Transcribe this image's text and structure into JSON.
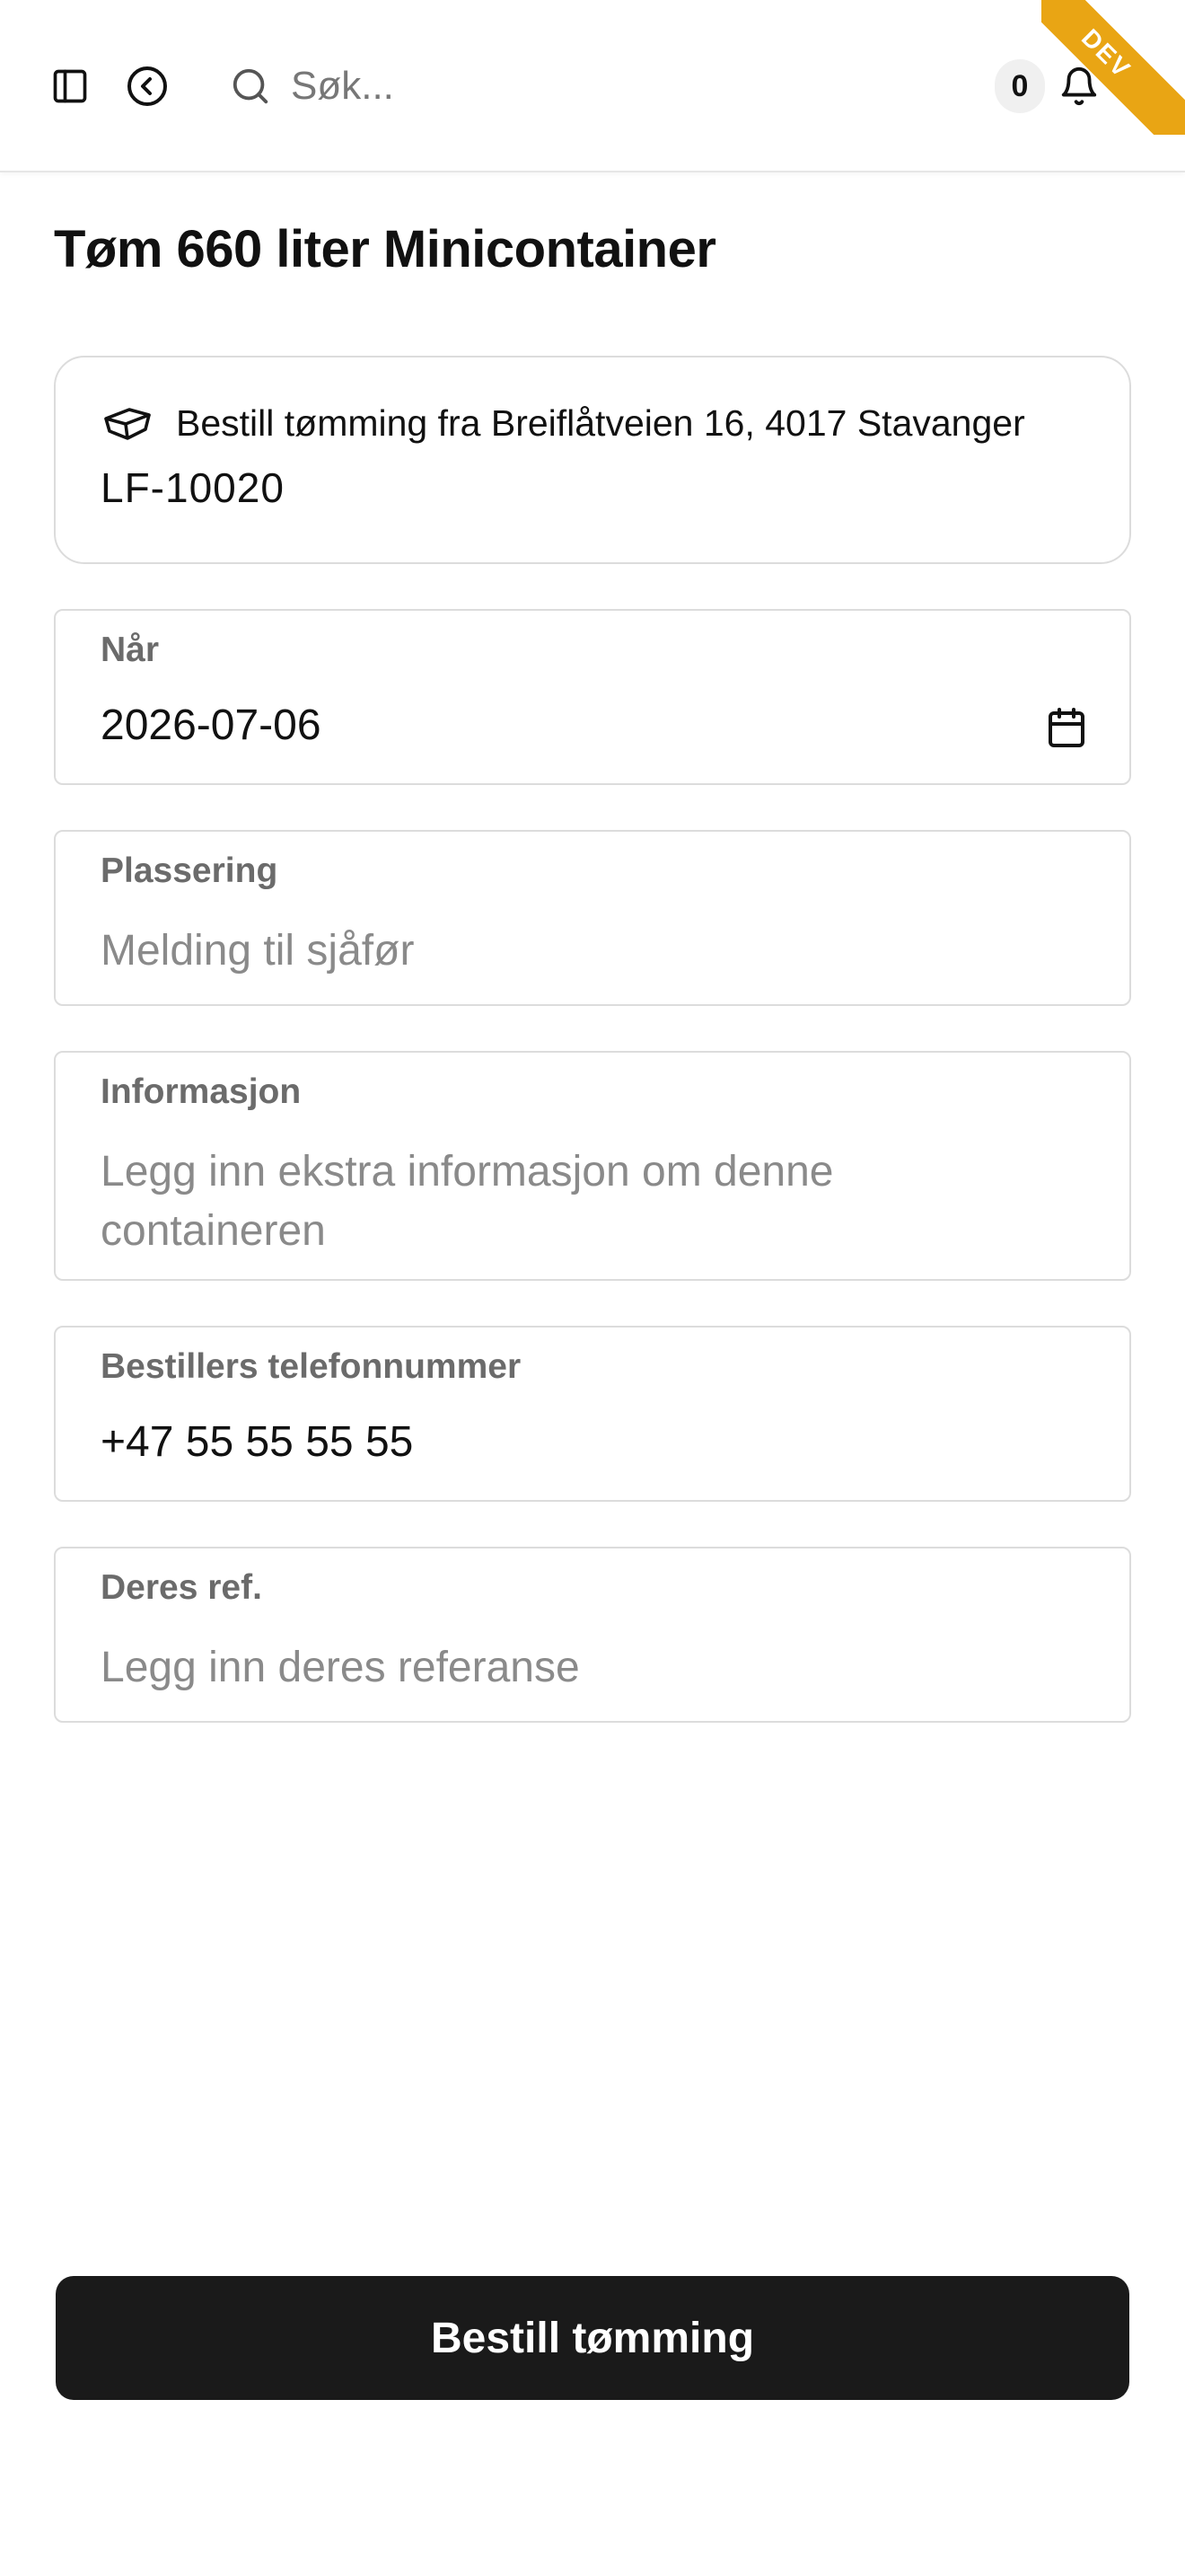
{
  "header": {
    "search_placeholder": "Søk...",
    "notification_count": "0",
    "env_badge": "DEV"
  },
  "page": {
    "title": "Tøm 660 liter Minicontainer"
  },
  "info_card": {
    "text": "Bestill tømming fra Breiflåtveien 16, 4017 Stavanger",
    "container_id": "LF-10020"
  },
  "form": {
    "date": {
      "label": "Når",
      "value": "2026-07-06"
    },
    "location": {
      "label": "Plassering",
      "placeholder": "Melding til sjåfør"
    },
    "information": {
      "label": "Informasjon",
      "placeholder": "Legg inn ekstra informasjon om denne containeren"
    },
    "phone": {
      "label": "Bestillers telefonnummer",
      "value": "+47 55 55 55 55"
    },
    "reference": {
      "label": "Deres ref.",
      "placeholder": "Legg inn deres referanse"
    }
  },
  "submit_label": "Bestill tømming",
  "colors": {
    "accent_ribbon": "#e9a514",
    "button_bg": "#1a1a1a",
    "border": "#dcdcdc"
  },
  "icons": [
    "sidebar-icon",
    "back-arrow-icon",
    "search-icon",
    "bell-icon",
    "container-icon",
    "calendar-icon"
  ]
}
